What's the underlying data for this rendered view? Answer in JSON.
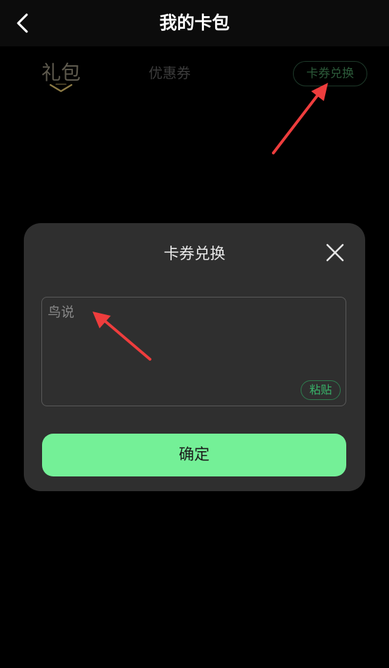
{
  "header": {
    "title": "我的卡包",
    "back_icon": "chevron-left-icon"
  },
  "tabs": [
    {
      "label": "礼包",
      "selected": true
    },
    {
      "label": "优惠券",
      "selected": false
    }
  ],
  "header_action": {
    "label": "卡券兑换"
  },
  "dialog": {
    "title": "卡券兑换",
    "close_icon": "close-icon",
    "input": {
      "value": "",
      "placeholder": "鸟说"
    },
    "paste_label": "粘贴",
    "confirm_label": "确定"
  },
  "colors": {
    "accent_green": "#74f097",
    "paste_green": "#38b46a",
    "annotation_red": "#ee3d3d",
    "gift_indicator_gold": "#8c7a45"
  }
}
